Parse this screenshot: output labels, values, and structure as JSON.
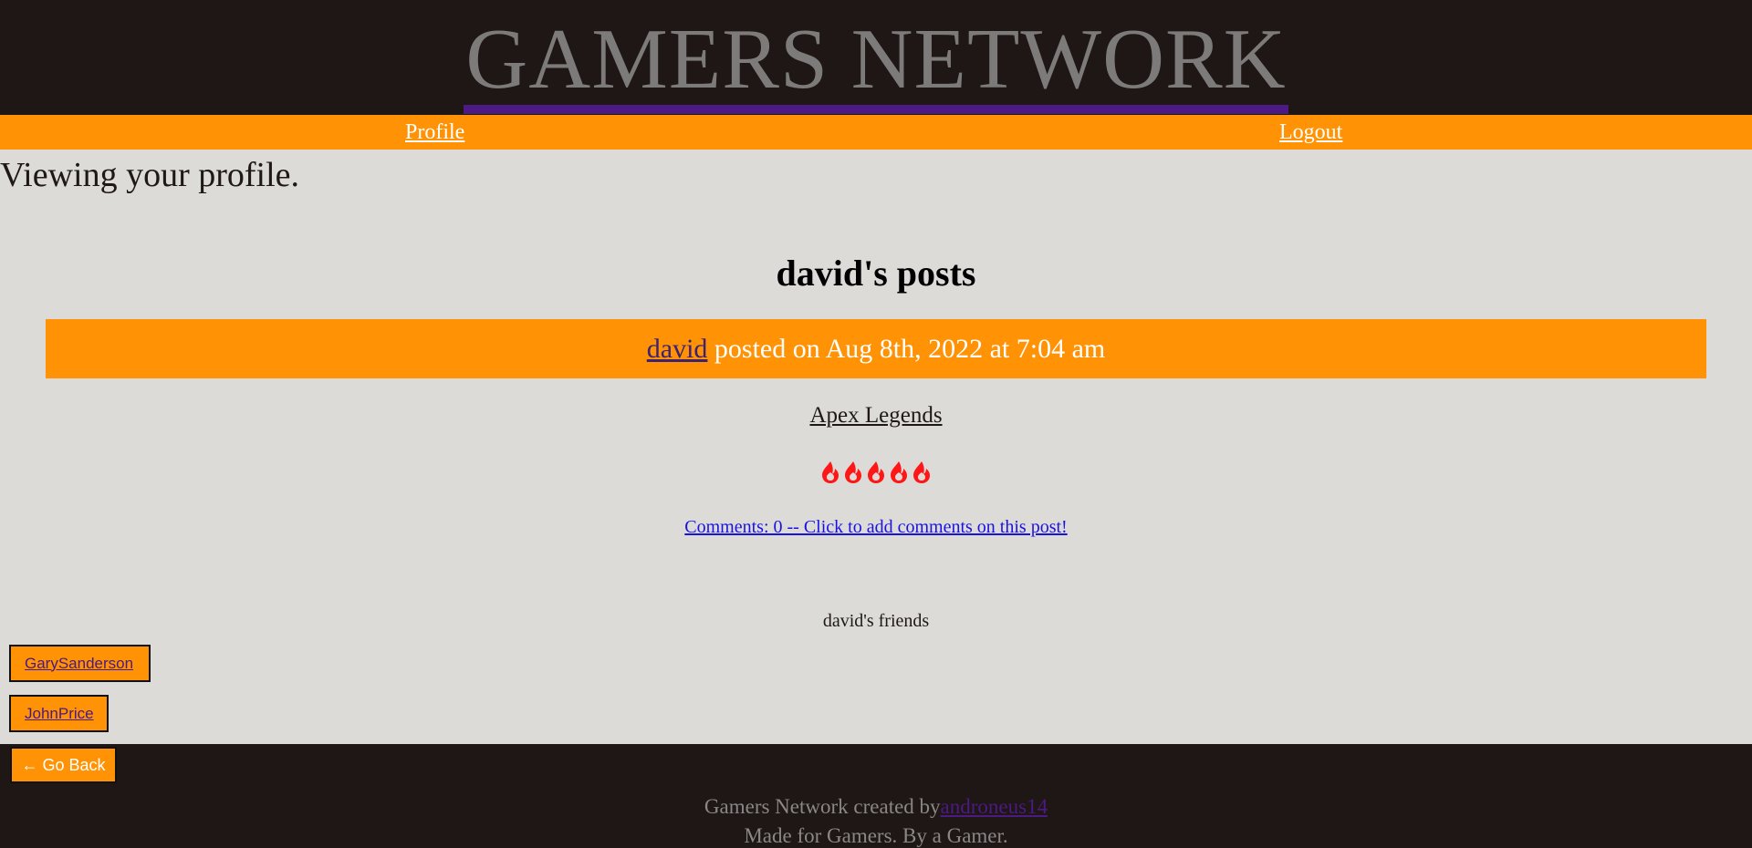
{
  "header": {
    "title": "GAMERS NETWORK"
  },
  "nav": {
    "profile_label": "Profile",
    "logout_label": "Logout"
  },
  "main": {
    "viewing_text": "Viewing your profile.",
    "posts_heading": "david's posts",
    "post": {
      "author": "david",
      "meta": " posted on Aug 8th, 2022 at 7:04 am",
      "game": "Apex Legends",
      "rating": 5,
      "rating_icon": "flame-icon",
      "rating_color": "#ff1616",
      "comments_link": "Comments: 0 -- Click to add comments on this post!"
    },
    "friends_heading": "david's friends",
    "friends": [
      "GarySanderson",
      "JohnPrice"
    ]
  },
  "footer": {
    "back_label": "← Go Back",
    "created_by_text": "Gamers Network created by",
    "created_by_author": "androneus14",
    "tagline": "Made for Gamers. By a Gamer."
  },
  "colors": {
    "accent": "#ff9305",
    "header_bg": "#1f1616",
    "page_bg": "#dcdbd8",
    "link_purple": "#4b1a82"
  }
}
